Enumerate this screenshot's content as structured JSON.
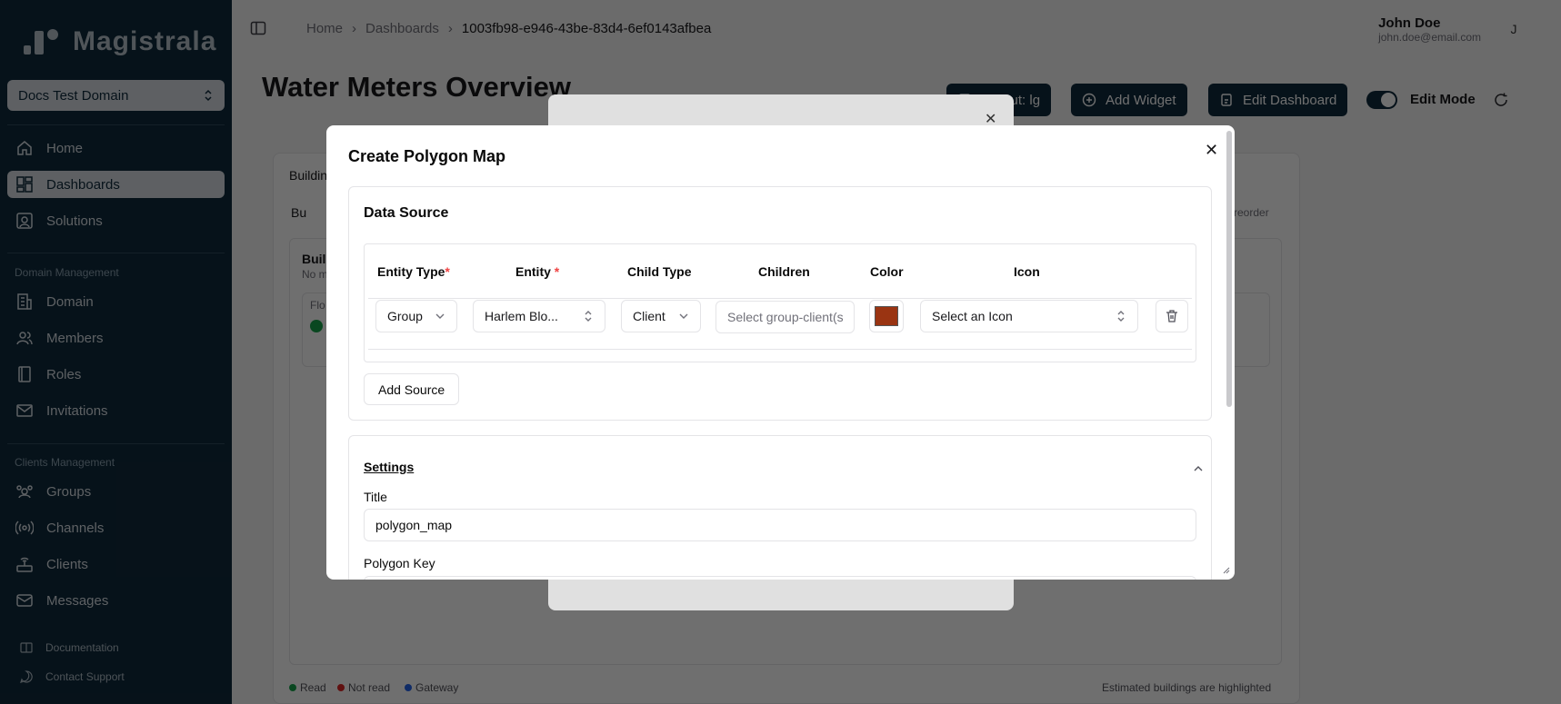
{
  "app": {
    "brand": "Magistrala"
  },
  "sidebar": {
    "domain_select": "Docs Test Domain",
    "main_items": [
      {
        "label": "Home",
        "icon": "home-icon"
      },
      {
        "label": "Dashboards",
        "icon": "dashboard-icon",
        "active": true
      },
      {
        "label": "Solutions",
        "icon": "solutions-icon"
      }
    ],
    "domain_section_label": "Domain Management",
    "domain_items": [
      {
        "label": "Domain",
        "icon": "building-icon"
      },
      {
        "label": "Members",
        "icon": "users-icon"
      },
      {
        "label": "Roles",
        "icon": "book-icon"
      },
      {
        "label": "Invitations",
        "icon": "mail-icon"
      }
    ],
    "clients_section_label": "Clients Management",
    "clients_items": [
      {
        "label": "Groups",
        "icon": "groups-icon"
      },
      {
        "label": "Channels",
        "icon": "radio-icon"
      },
      {
        "label": "Clients",
        "icon": "router-icon"
      },
      {
        "label": "Messages",
        "icon": "messages-icon"
      }
    ],
    "footer_items": [
      {
        "label": "Documentation",
        "icon": "docs-icon"
      },
      {
        "label": "Contact Support",
        "icon": "chat-icon"
      }
    ]
  },
  "header": {
    "breadcrumb": [
      "Home",
      "Dashboards",
      "1003fb98-e946-43be-83d4-6ef0143afbea"
    ],
    "user_name": "John Doe",
    "user_email": "john.doe@email.com",
    "avatar_initial": "J"
  },
  "page": {
    "title": "Water Meters Overview",
    "layout_button": "Layout: lg",
    "add_widget_button": "Add Widget",
    "edit_dashboard_button": "Edit Dashboard",
    "edit_mode_label": "Edit Mode",
    "edit_mode_on": true
  },
  "background": {
    "widget_title": "Buildin",
    "widget_sub": "Bu",
    "card_title": "Buil",
    "card_sub": "No m",
    "inner_label": "Flo",
    "reorder_hint": "o reorder",
    "legend": [
      {
        "label": "Read",
        "color": "#16a34a"
      },
      {
        "label": "Not read",
        "color": "#dc2626"
      },
      {
        "label": "Gateway",
        "color": "#2563eb"
      }
    ],
    "estimated_note": "Estimated buildings are highlighted"
  },
  "modal": {
    "title": "Create Polygon Map",
    "data_source": {
      "title": "Data Source",
      "headers": {
        "entity_type": "Entity Type",
        "entity": "Entity",
        "child_type": "Child Type",
        "children": "Children",
        "color": "Color",
        "icon": "Icon"
      },
      "row": {
        "entity_type": "Group",
        "entity": "Harlem Blo...",
        "child_type": "Client",
        "children_placeholder": "Select group-client(s)",
        "color": "#9a3412",
        "icon_placeholder": "Select an Icon"
      },
      "add_source_button": "Add Source"
    },
    "settings": {
      "title": "Settings",
      "title_label": "Title",
      "title_value": "polygon_map",
      "polygon_key_label": "Polygon Key"
    }
  }
}
